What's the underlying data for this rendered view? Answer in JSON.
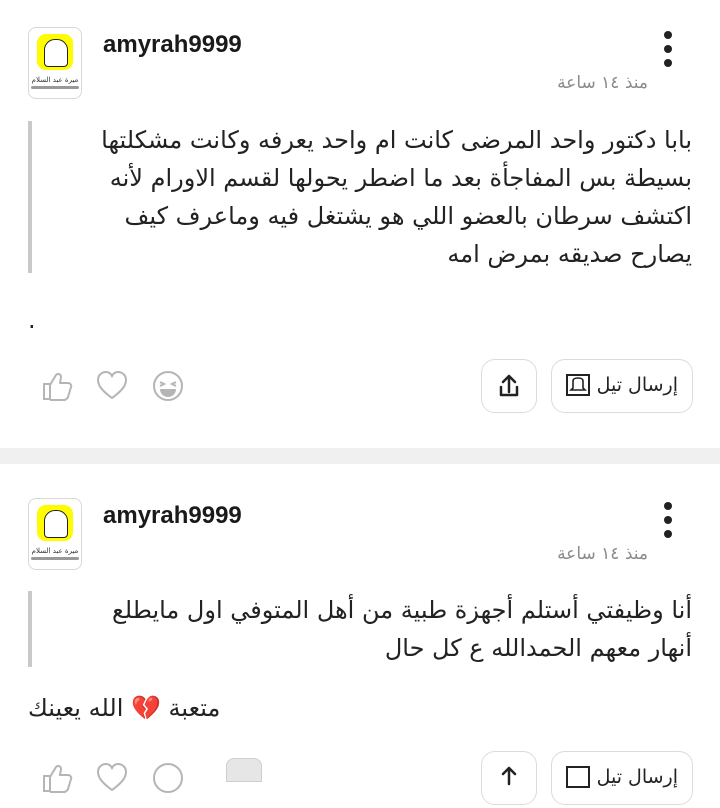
{
  "posts": [
    {
      "username": "amyrah9999",
      "avatar_caption": "ميرة عبد السلام",
      "time": "منذ ١٤ ساعة",
      "quote_lines": [
        "بابا دكتور واحد المرضى كانت ام واحد يعرفه وكانت مشكلتها",
        "بسيطة بس المفاجأة بعد ما اضطر يحولها لقسم الاورام لأنه",
        "اكتشف سرطان بالعضو اللي هو يشتغل فيه وماعرف كيف",
        "يصارح صديقه بمرض امه"
      ],
      "body": ".",
      "send_label": "إرسال تيل"
    },
    {
      "username": "amyrah9999",
      "avatar_caption": "ميرة عبد السلام",
      "time": "منذ ١٤ ساعة",
      "quote_lines": [
        "أنا وظيفتي أستلم أجهزة طبية من أهل المتوفي اول مايطلع",
        "أنهار معهم الحمدالله ع كل حال"
      ],
      "body": "متعبة 💔 الله يعينك",
      "send_label": "إرسال تيل"
    }
  ],
  "icons": {
    "like": "thumbs-up-icon",
    "love": "heart-icon",
    "laugh": "laughing-face-icon",
    "share": "share-icon",
    "send": "ghost-tell-icon",
    "menu": "more-vertical-icon"
  },
  "colors": {
    "icon_gray": "#b5b5b5",
    "divider": "#f0f0f0",
    "snap_yellow": "#fffc00"
  }
}
